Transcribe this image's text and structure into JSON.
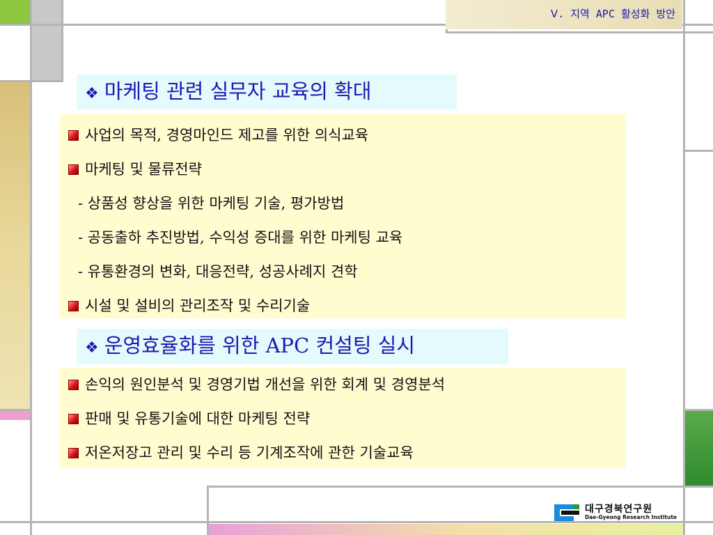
{
  "header": {
    "title": "Ⅴ. 지역 APC 활성화 방안"
  },
  "section1": {
    "heading": "마케팅 관련 실무자 교육의 확대",
    "items": [
      {
        "kind": "bullet",
        "text": "사업의 목적, 경영마인드 제고를 위한 의식교육"
      },
      {
        "kind": "bullet",
        "text": "마케팅 및 물류전략"
      },
      {
        "kind": "sub",
        "text": "- 상품성 향상을 위한 마케팅 기술, 평가방법"
      },
      {
        "kind": "sub",
        "text": "- 공동출하 추진방법, 수익성 증대를 위한 마케팅 교육"
      },
      {
        "kind": "sub",
        "text": "- 유통환경의 변화, 대응전략, 성공사례지 견학"
      },
      {
        "kind": "bullet",
        "text": "시설 및 설비의 관리조작 및 수리기술"
      }
    ]
  },
  "section2": {
    "heading": "운영효율화를 위한 APC 컨설팅 실시",
    "items": [
      {
        "kind": "bullet",
        "text": "손익의 원인분석 및 경영기법 개선을 위한 회계 및 경영분석"
      },
      {
        "kind": "bullet",
        "text": "판매 및 유통기술에 대한 마케팅 전략"
      },
      {
        "kind": "bullet",
        "text": "저온저장고 관리 및 수리 등 기계조작에 관한 기술교육"
      }
    ]
  },
  "logo": {
    "name_ko": "대구경북연구원",
    "name_en": "Dae-Gyeong Research Institute"
  },
  "colors": {
    "heading_text": "#1a1ab0",
    "heading_bg": "#e4fafc",
    "panel_bg": "#fffdd0",
    "bullet": "#e01010",
    "accent_green": "#8dc63f",
    "accent_pink": "#f0a0d0",
    "dark_green": "#2e8b2e"
  }
}
